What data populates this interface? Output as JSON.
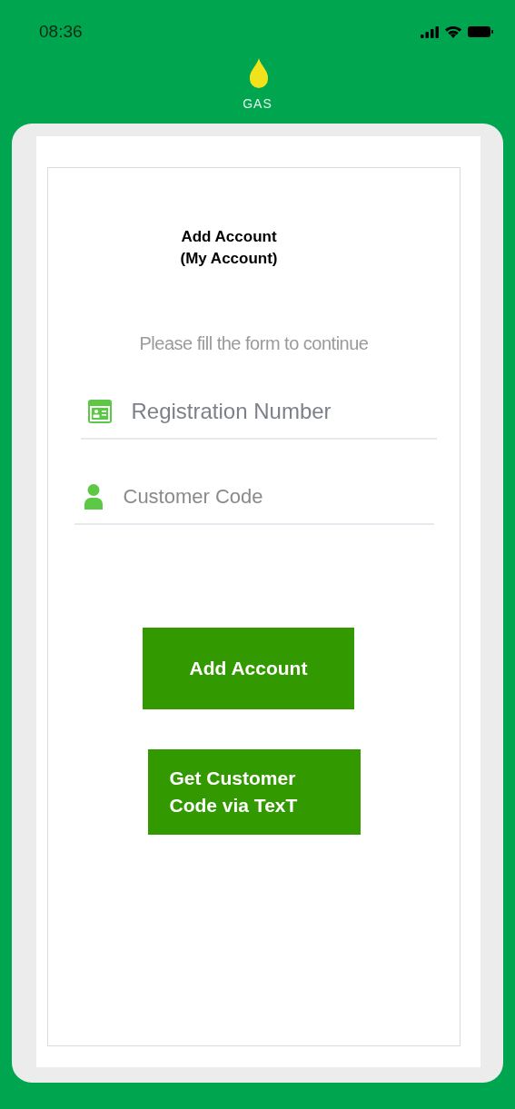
{
  "status_bar": {
    "time": "08:36"
  },
  "logo": {
    "text": "GAS"
  },
  "form": {
    "title": "Add Account\n(My Account)",
    "subtitle": "Please fill the form to continue",
    "fields": [
      {
        "kind": "id-card",
        "placeholder": "Registration Number"
      },
      {
        "kind": "person",
        "placeholder": "Customer Code"
      }
    ],
    "buttons": [
      {
        "label": "Add Account"
      },
      {
        "label": "Get Customer\nCode via TexT"
      }
    ]
  }
}
